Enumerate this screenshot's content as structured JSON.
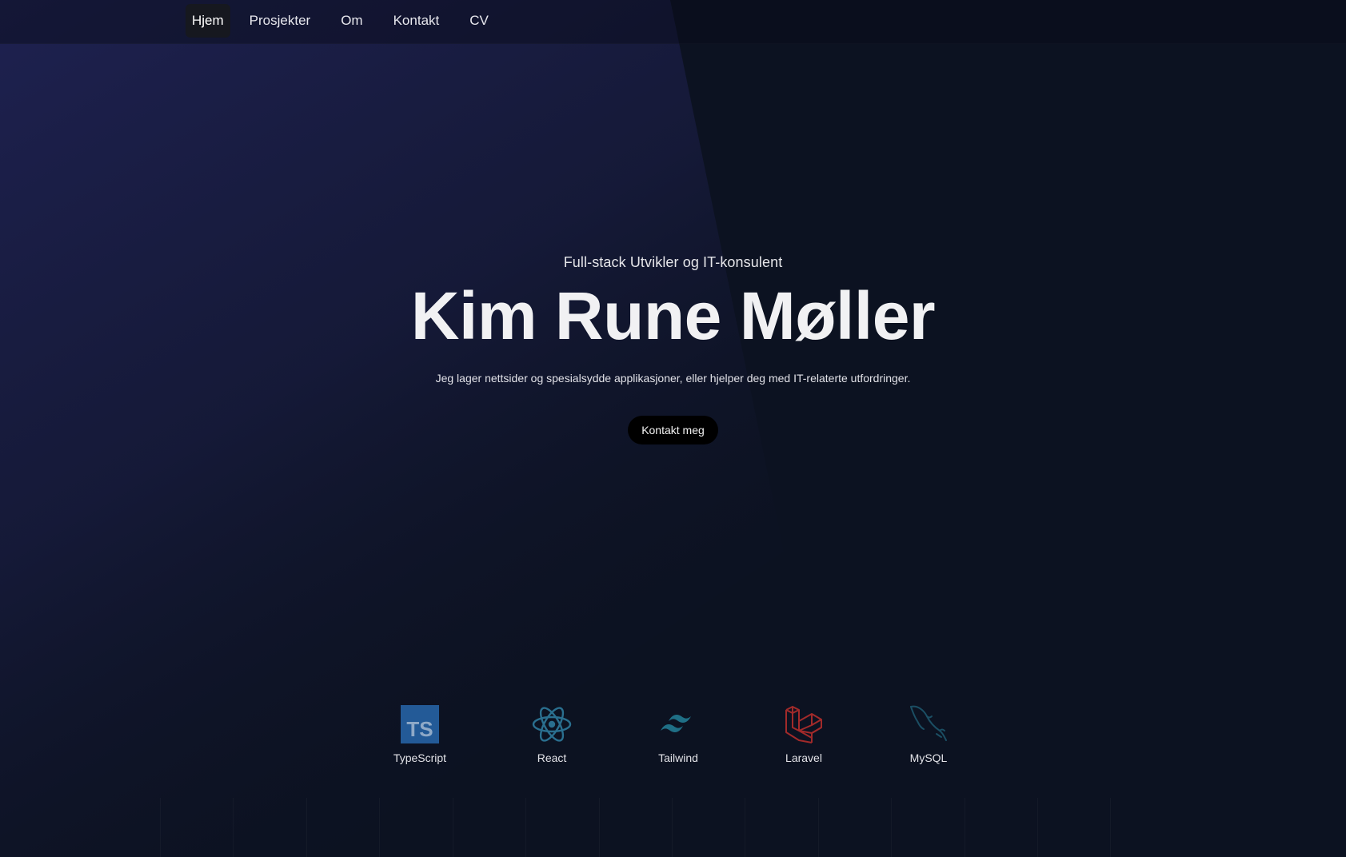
{
  "nav": {
    "items": [
      {
        "label": "Hjem",
        "active": true
      },
      {
        "label": "Prosjekter",
        "active": false
      },
      {
        "label": "Om",
        "active": false
      },
      {
        "label": "Kontakt",
        "active": false
      },
      {
        "label": "CV",
        "active": false
      }
    ]
  },
  "hero": {
    "subtitle": "Full-stack Utvikler og IT-konsulent",
    "name": "Kim Rune Møller",
    "tagline": "Jeg lager nettsider og spesialsydde applikasjoner, eller hjelper deg med IT-relaterte utfordringer.",
    "cta_label": "Kontakt meg"
  },
  "tech_stack": [
    {
      "name": "TypeScript",
      "icon": "typescript-icon",
      "color": "#235a97"
    },
    {
      "name": "React",
      "icon": "react-icon",
      "color": "#2a6f8f"
    },
    {
      "name": "Tailwind",
      "icon": "tailwind-icon",
      "color": "#1f6f86"
    },
    {
      "name": "Laravel",
      "icon": "laravel-icon",
      "color": "#a12a2a"
    },
    {
      "name": "MySQL",
      "icon": "mysql-icon",
      "color": "#1b4e63"
    }
  ],
  "colors": {
    "background": "#0c1221",
    "beam": "#1c1f45",
    "text": "#f1f1f3",
    "cta_background": "#000000"
  }
}
